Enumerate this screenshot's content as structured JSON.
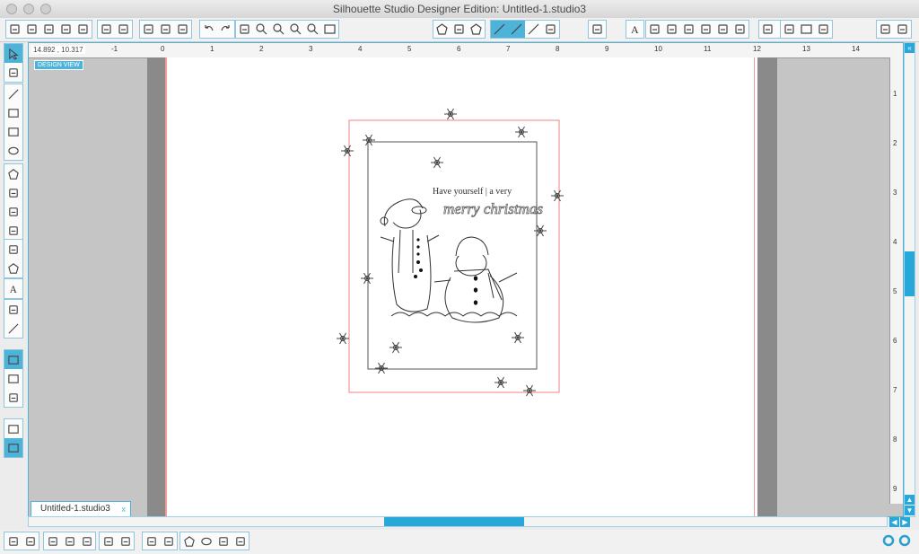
{
  "window": {
    "title": "Silhouette Studio Designer Edition: Untitled-1.studio3"
  },
  "ruler": {
    "coords": "14.892 , 10.317",
    "labels": [
      "-1",
      "0",
      "1",
      "2",
      "3",
      "4",
      "5",
      "6",
      "7",
      "8",
      "9",
      "10",
      "11",
      "12",
      "13",
      "14"
    ],
    "vlabels": [
      "1",
      "2",
      "3",
      "4",
      "5",
      "6",
      "7",
      "8",
      "9"
    ]
  },
  "design_view": {
    "label": "DESIGN VIEW"
  },
  "doc_tab": {
    "label": "Untitled-1.studio3",
    "close": "x"
  },
  "artwork": {
    "line1": "Have yourself | a very",
    "line2": "merry christmas"
  },
  "colors": {
    "accent": "#4db3d9",
    "cut_border": "#f08080",
    "scroll": "#27a8d8"
  },
  "icons": {
    "top_groups": [
      [
        "new-document-icon",
        "open-icon",
        "save-icon",
        "save-to-library-icon",
        "save-as-icon"
      ],
      [
        "print-icon",
        "send-to-silhouette-icon"
      ],
      [
        "copy-icon",
        "paste-icon",
        "cut-icon"
      ],
      [
        "undo-icon",
        "redo-icon"
      ],
      [
        "pan-icon",
        "zoom-in-icon",
        "zoom-out-icon",
        "zoom-box-icon",
        "zoom-drag-icon",
        "fit-to-page-icon"
      ],
      [
        "fill-color-icon",
        "gradient-icon",
        "fill-pattern-icon"
      ],
      [
        "line-color-icon",
        "line-style-icon",
        "line-styles-icon",
        "sketch-icon"
      ],
      [
        "cut-settings-icon"
      ],
      [
        "text-style-icon"
      ],
      [
        "transform-icon",
        "rotate-icon",
        "scale-icon",
        "shear-icon",
        "align-icon",
        "replicate-icon"
      ],
      [
        "modify-icon",
        "offset-icon"
      ],
      [
        "trace-icon",
        "page-setup-icon",
        "grid-icon"
      ],
      [
        "send-icon",
        "library-icon"
      ]
    ],
    "left_groups": [
      [
        "select-icon",
        "edit-points-icon"
      ],
      [
        "line-tool-icon",
        "rectangle-tool-icon",
        "rounded-rectangle-icon",
        "ellipse-tool-icon"
      ],
      [
        "polygon-tool-icon",
        "curve-tool-icon",
        "freehand-tool-icon",
        "smooth-freehand-icon"
      ],
      [
        "arc-tool-icon",
        "regular-polygon-icon"
      ],
      [
        "text-tool-icon"
      ],
      [
        "eraser-icon",
        "knife-icon"
      ],
      [
        "design-view-icon",
        "library-view-icon",
        "store-icon"
      ],
      [
        "design-page-icon",
        "split-view-icon"
      ]
    ],
    "bottom_groups": [
      [
        "group-icon",
        "ungroup-icon"
      ],
      [
        "make-compound-icon",
        "release-compound-icon",
        "bring-to-front-icon"
      ],
      [
        "weld-icon",
        "delete-icon"
      ],
      [
        "duplicate-icon",
        "mirror-icon"
      ],
      [
        "fill-icon",
        "spiral-icon",
        "move-icon",
        "send-backward-icon"
      ]
    ],
    "bottom_right": [
      "settings-gear-icon",
      "refresh-icon"
    ]
  }
}
